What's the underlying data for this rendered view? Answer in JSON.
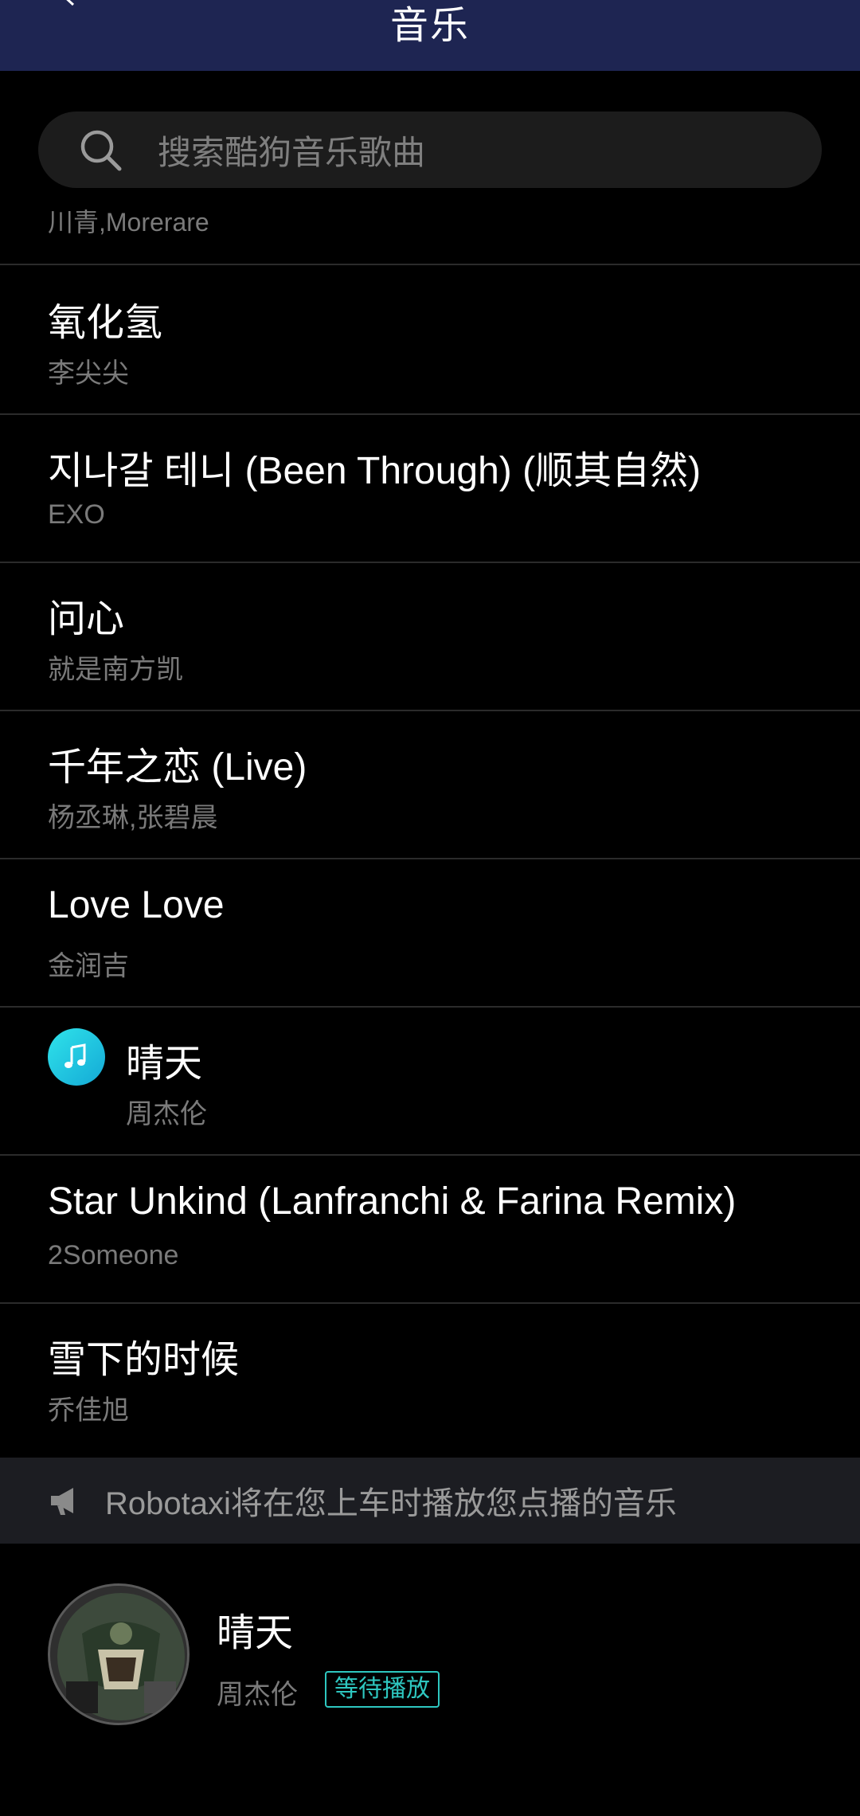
{
  "header": {
    "title": "音乐"
  },
  "search": {
    "placeholder": "搜索酷狗音乐歌曲"
  },
  "list": {
    "partial_artist": "川青,Morerare",
    "songs": [
      {
        "title": "氧化氢",
        "artist": "李尖尖"
      },
      {
        "title": "지나갈 테니 (Been Through) (顺其自然)",
        "artist": "EXO"
      },
      {
        "title": "问心",
        "artist": "就是南方凯"
      },
      {
        "title": "千年之恋 (Live)",
        "artist": "杨丞琳,张碧晨"
      },
      {
        "title": "Love Love",
        "artist": "金润吉"
      },
      {
        "title": "晴天",
        "artist": "周杰伦",
        "playing": true
      },
      {
        "title": "Star Unkind (Lanfranchi & Farina Remix)",
        "artist": "2Someone"
      },
      {
        "title": "雪下的时候",
        "artist": "乔佳旭"
      }
    ]
  },
  "notice": {
    "text": "Robotaxi将在您上车时播放您点播的音乐",
    "icon": "megaphone-icon"
  },
  "player": {
    "title": "晴天",
    "artist": "周杰伦",
    "status": "等待播放"
  },
  "colors": {
    "header_bg": "#1e2552",
    "accent": "#2ec7c0",
    "playing_gradient_start": "#2fe3ea",
    "playing_gradient_end": "#14a9d6"
  }
}
